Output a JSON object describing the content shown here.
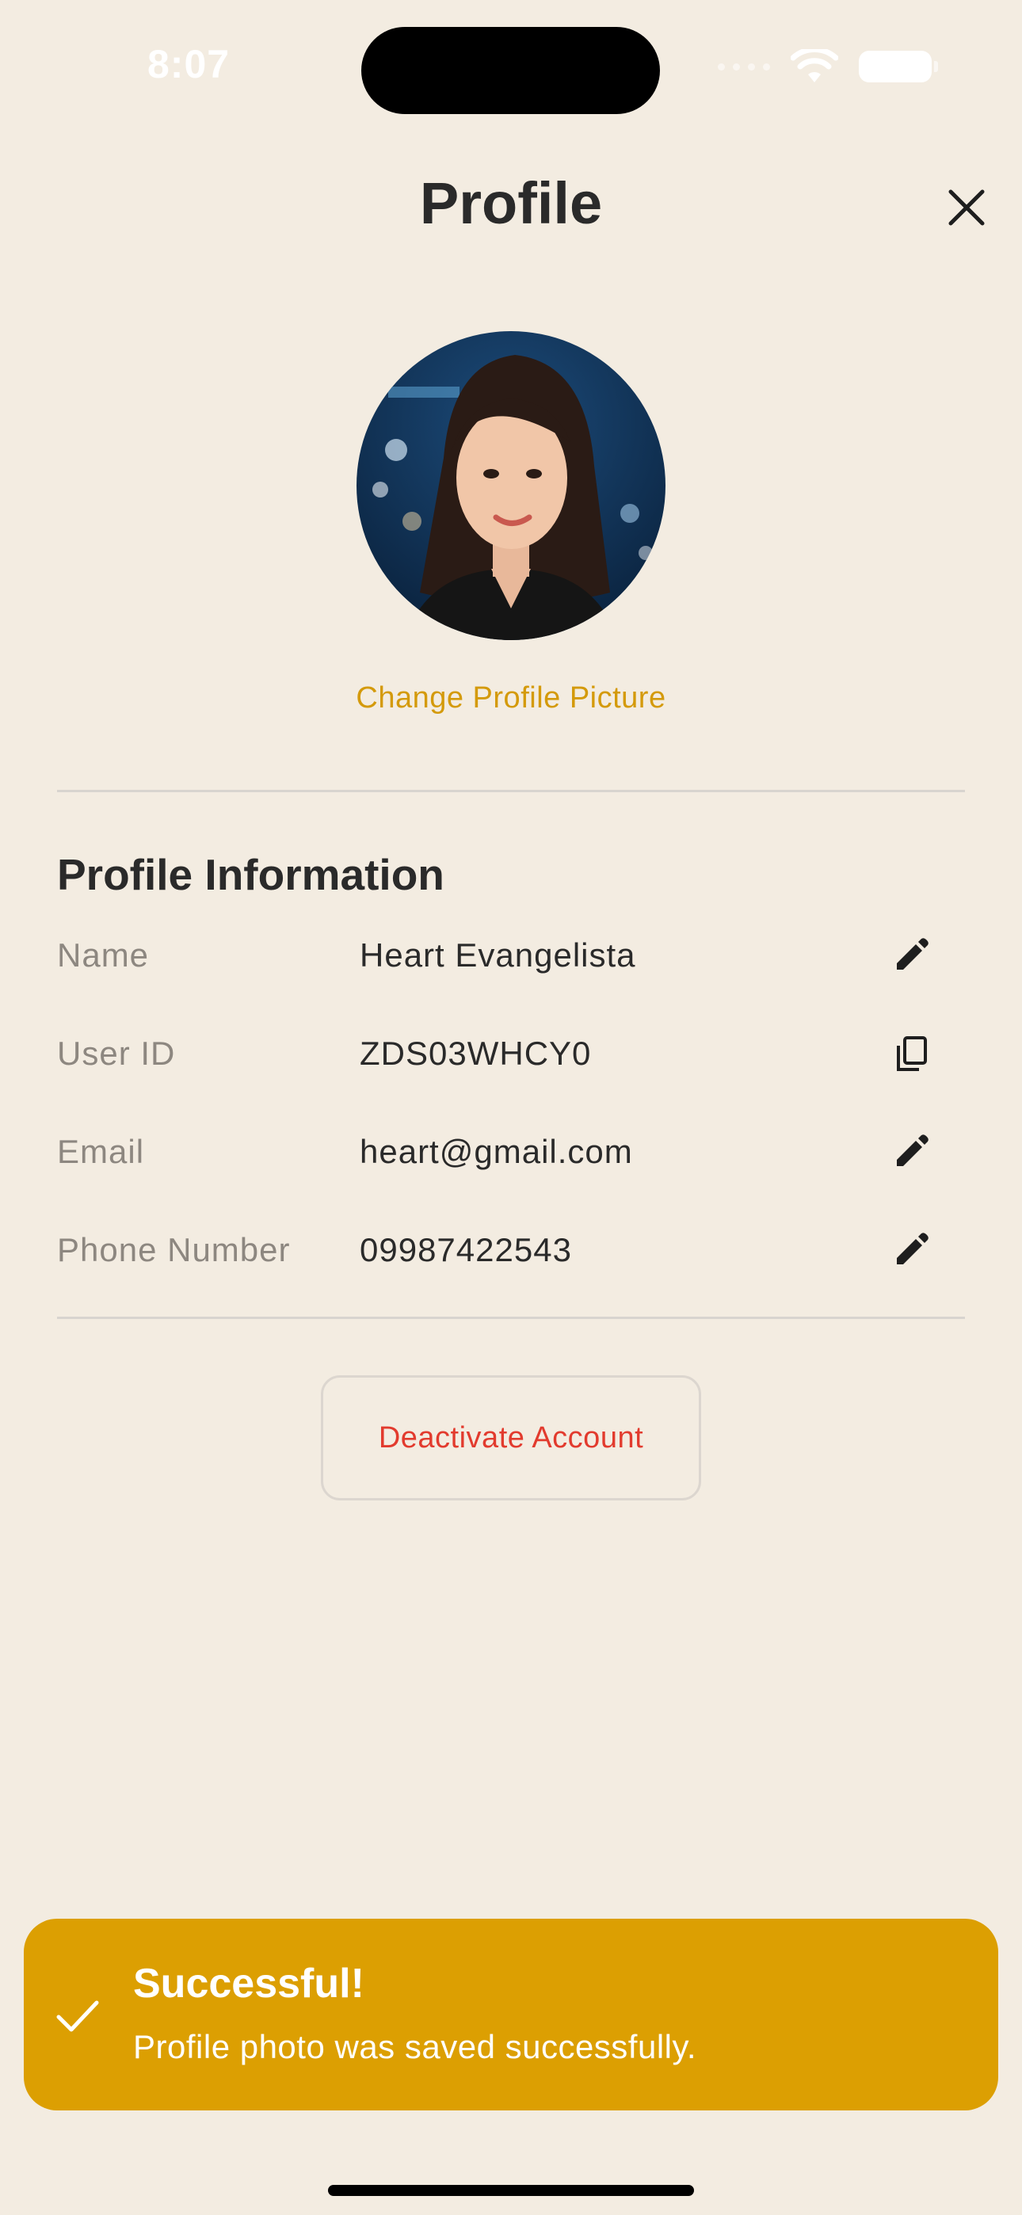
{
  "status_bar": {
    "time": "8:07"
  },
  "header": {
    "title": "Profile"
  },
  "avatar": {
    "change_label": "Change Profile Picture"
  },
  "profile_info": {
    "section_title": "Profile Information",
    "rows": [
      {
        "label": "Name",
        "value": "Heart Evangelista",
        "action_icon": "pencil-icon"
      },
      {
        "label": "User ID",
        "value": "ZDS03WHCY0",
        "action_icon": "copy-icon"
      },
      {
        "label": "Email",
        "value": "heart@gmail.com",
        "action_icon": "pencil-icon"
      },
      {
        "label": "Phone Number",
        "value": "09987422543",
        "action_icon": "pencil-icon"
      }
    ]
  },
  "actions": {
    "deactivate_label": "Deactivate Account"
  },
  "toast": {
    "title": "Successful!",
    "message": "Profile photo was saved successfully.",
    "icon": "checkmark-icon"
  },
  "colors": {
    "background": "#F3ECE1",
    "accent": "#D49A0B",
    "toast": "#DC9F02",
    "danger": "#E23B2E"
  }
}
